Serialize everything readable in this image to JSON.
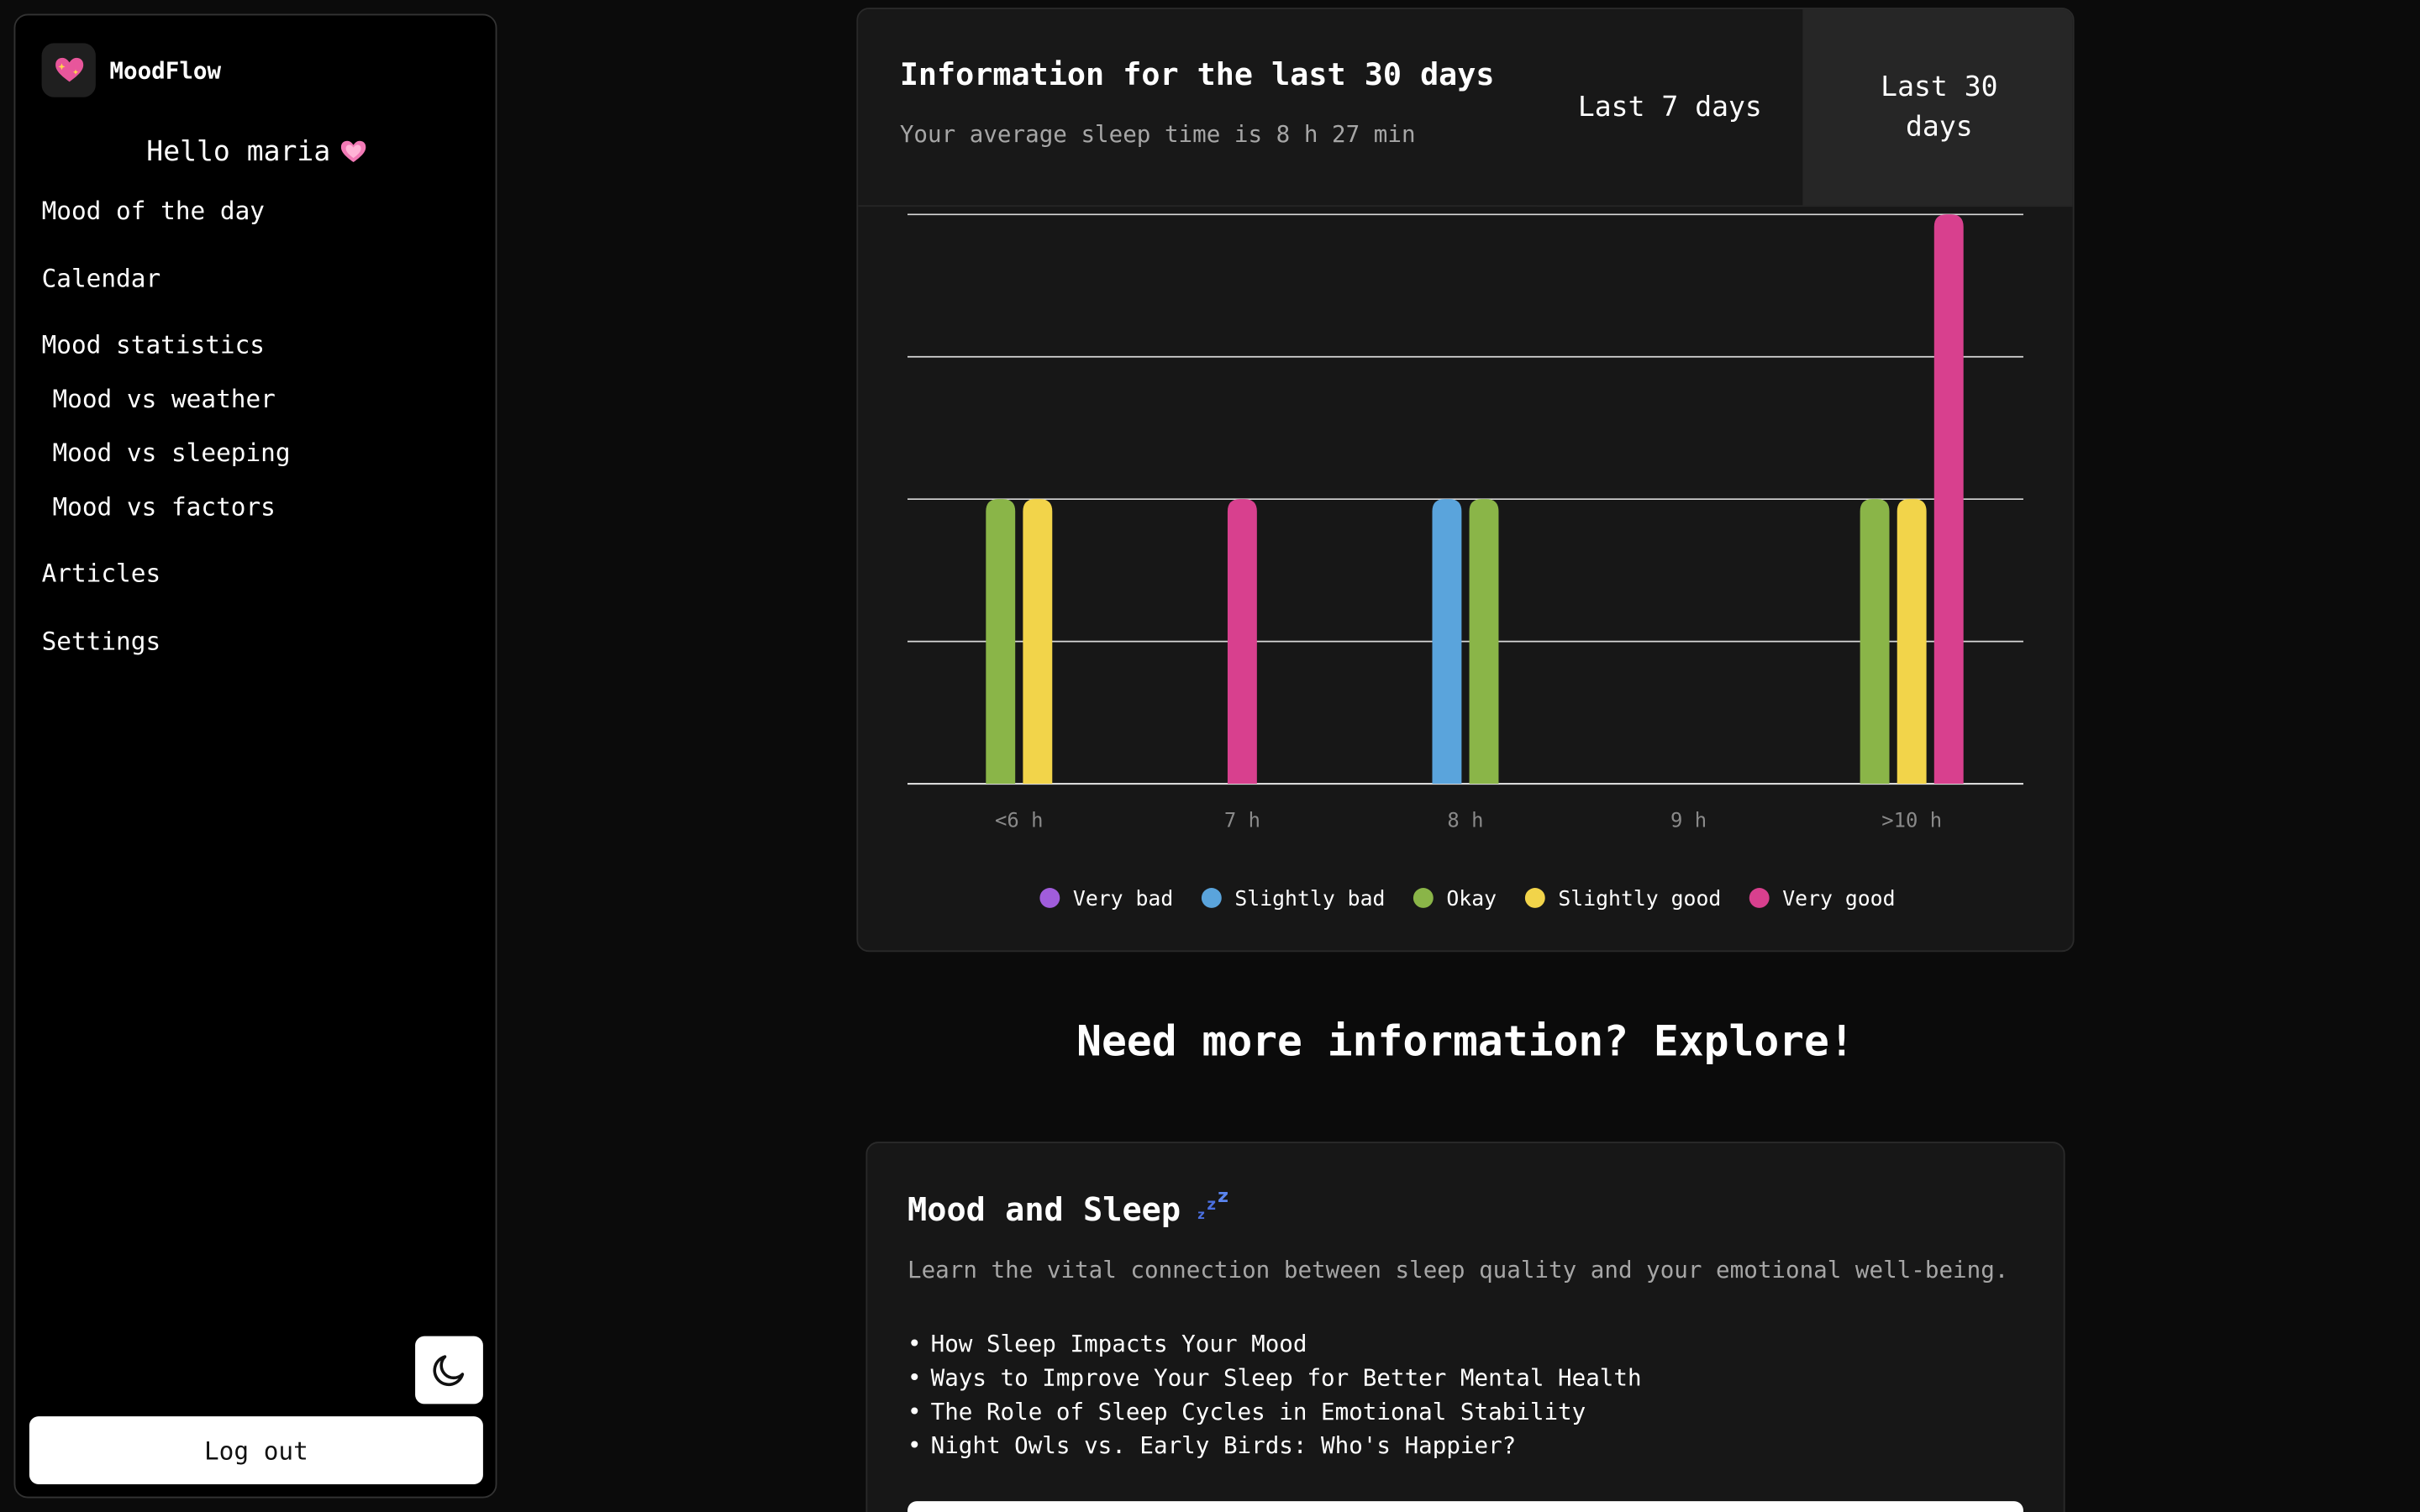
{
  "app": {
    "name": "MoodFlow",
    "logo_icon": "sparkling-heart-icon"
  },
  "sidebar": {
    "greeting": "Hello maria",
    "greeting_icon": "pink-heart-icon",
    "items": [
      {
        "label": "Mood of the day"
      },
      {
        "label": "Calendar"
      },
      {
        "label": "Mood statistics"
      },
      {
        "label": "Mood vs weather"
      },
      {
        "label": "Mood vs sleeping"
      },
      {
        "label": "Mood vs factors"
      },
      {
        "label": "Articles"
      },
      {
        "label": "Settings"
      }
    ],
    "theme_toggle_icon": "moon-icon",
    "logout_label": "Log out"
  },
  "stats": {
    "title": "Information for the last 30 days",
    "subtitle": "Your average sleep time is 8 h 27 min",
    "ranges": [
      {
        "label": "Last 7 days",
        "active": false
      },
      {
        "label": "Last 30 days",
        "active": true
      }
    ]
  },
  "chart_data": {
    "type": "bar",
    "categories": [
      "<6 h",
      "7 h",
      "8 h",
      "9 h",
      ">10 h"
    ],
    "series": [
      {
        "name": "Very bad",
        "color": "#a05ddb",
        "values": [
          0,
          0,
          0,
          0,
          0
        ]
      },
      {
        "name": "Slightly bad",
        "color": "#5aa4dc",
        "values": [
          0,
          0,
          2,
          0,
          0
        ]
      },
      {
        "name": "Okay",
        "color": "#8ab548",
        "values": [
          2,
          0,
          2,
          0,
          2
        ]
      },
      {
        "name": "Slightly good",
        "color": "#f2d44a",
        "values": [
          2,
          0,
          0,
          0,
          2
        ]
      },
      {
        "name": "Very good",
        "color": "#d8408e",
        "values": [
          0,
          2,
          0,
          0,
          4
        ]
      }
    ],
    "ylim": [
      0,
      4
    ],
    "grid": true,
    "legend": "bottom"
  },
  "explore": {
    "heading": "Need more information? Explore!",
    "article": {
      "title": "Mood and Sleep",
      "title_icon": "zzz-icon",
      "description": "Learn the vital connection between sleep quality and your emotional well-being.",
      "links": [
        "How Sleep Impacts Your Mood",
        "Ways to Improve Your Sleep for Better Mental Health",
        "The Role of Sleep Cycles in Emotional Stability",
        "Night Owls vs. Early Birds: Who's Happier?"
      ]
    }
  }
}
